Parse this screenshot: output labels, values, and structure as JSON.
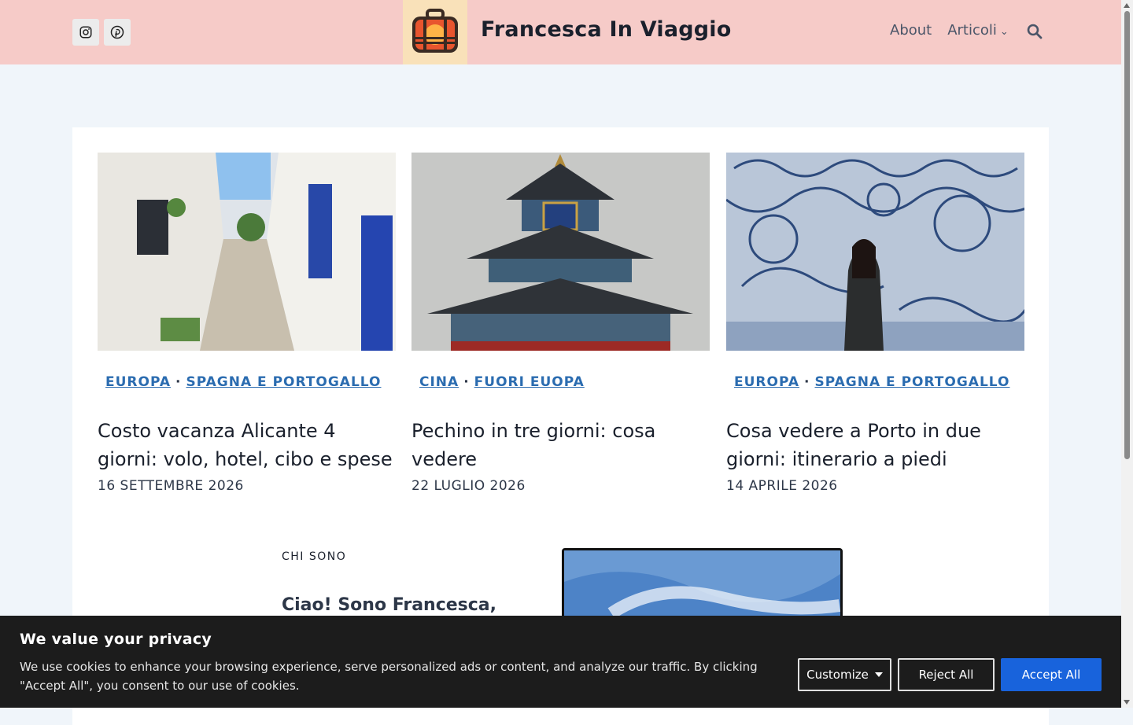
{
  "header": {
    "site_title": "Francesca In Viaggio",
    "social": [
      "instagram-icon",
      "pinterest-icon"
    ],
    "nav": [
      {
        "label": "About"
      },
      {
        "label": "Articoli",
        "has_dropdown": true
      }
    ],
    "colors": {
      "background": "#f6cbc8",
      "logo_background": "#f9e1b9"
    }
  },
  "posts": [
    {
      "categories": [
        "EUROPA",
        "SPAGNA E PORTOGALLO"
      ],
      "title": "Costo vacanza Alicante 4 giorni: volo, hotel, cibo e spese",
      "date": "16 SETTEMBRE 2026"
    },
    {
      "categories": [
        "CINA",
        "FUORI EUOPA"
      ],
      "title": "Pechino in tre giorni: cosa vedere",
      "date": "22 LUGLIO 2026"
    },
    {
      "categories": [
        "EUROPA",
        "SPAGNA E PORTOGALLO"
      ],
      "title": "Cosa vedere a Porto in due giorni: itinerario a piedi",
      "date": "14 APRILE 2026"
    }
  ],
  "about": {
    "label": "CHI SONO",
    "heading": "Ciao! Sono Francesca,"
  },
  "cookie_banner": {
    "title": "We value your privacy",
    "text": "We use cookies to enhance your browsing experience, serve personalized ads or content, and analyze our traffic. By clicking \"Accept All\", you consent to our use of cookies.",
    "customize_label": "Customize",
    "reject_label": "Reject All",
    "accept_label": "Accept All",
    "colors": {
      "background": "#1c1c1c",
      "accept": "#1863dc"
    }
  },
  "colors": {
    "link": "#2b6cb0",
    "page_background": "#f0f5fa"
  }
}
